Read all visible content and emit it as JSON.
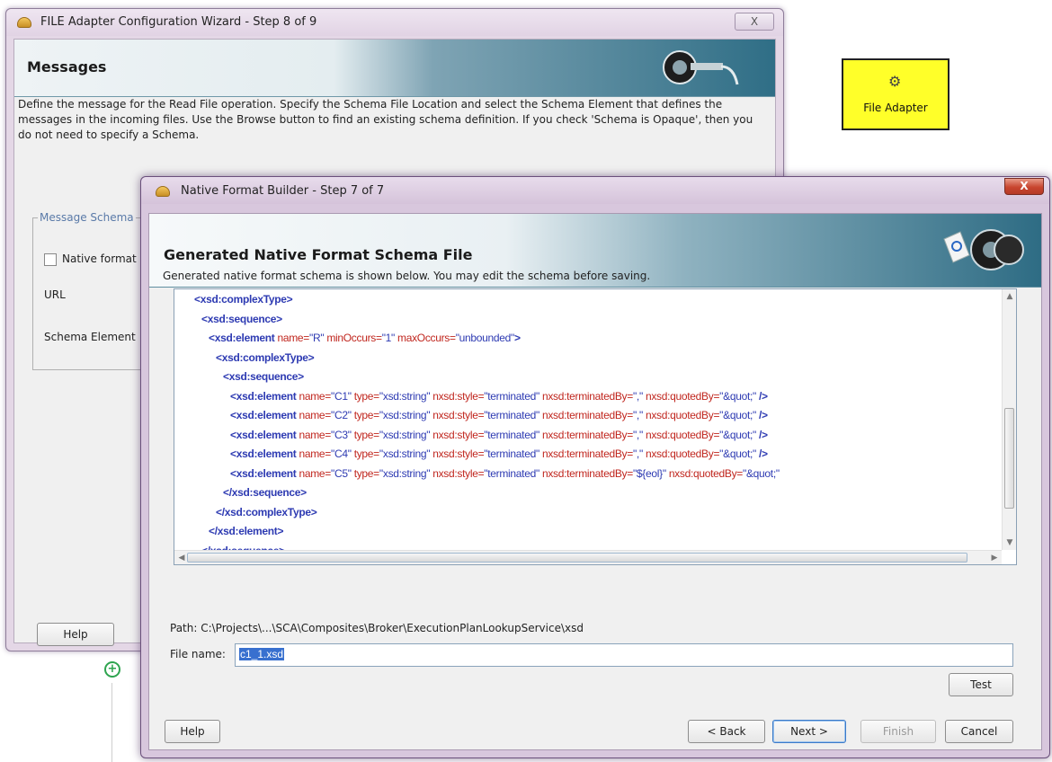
{
  "back_dialog": {
    "title": "FILE Adapter Configuration Wizard - Step 8 of 9",
    "close_label": "X",
    "banner_title": "Messages",
    "description": "Define the message for the Read File operation.  Specify the Schema File Location and select the Schema Element that defines the messages in the incoming files. Use the Browse button to find an existing schema definition. If you check 'Schema is Opaque', then you do not need to specify a Schema.",
    "group_label": "Message Schema",
    "native_format_label": "Native format",
    "url_label": "URL",
    "schema_element_label": "Schema Element",
    "help_label": "Help"
  },
  "canvas": {
    "adapter_label": "File Adapter"
  },
  "front_dialog": {
    "title": "Native Format Builder - Step 7 of 7",
    "close_label": "X",
    "banner_title": "Generated Native Format Schema File",
    "intro": "Generated native format schema is shown below. You may edit the schema before saving.",
    "code_lines": [
      {
        "indent": 0,
        "parts": [
          {
            "c": "t",
            "s": "<xsd:complexType>"
          }
        ]
      },
      {
        "indent": 1,
        "parts": [
          {
            "c": "t",
            "s": "<xsd:sequence>"
          }
        ]
      },
      {
        "indent": 2,
        "parts": [
          {
            "c": "t",
            "s": "<xsd:element "
          },
          {
            "c": "a",
            "s": "name="
          },
          {
            "c": "v",
            "s": "\"R\" "
          },
          {
            "c": "a",
            "s": "minOccurs="
          },
          {
            "c": "v",
            "s": "\"1\" "
          },
          {
            "c": "a",
            "s": "maxOccurs="
          },
          {
            "c": "v",
            "s": "\"unbounded\""
          },
          {
            "c": "t",
            "s": ">"
          }
        ]
      },
      {
        "indent": 3,
        "parts": [
          {
            "c": "t",
            "s": "<xsd:complexType>"
          }
        ]
      },
      {
        "indent": 4,
        "parts": [
          {
            "c": "t",
            "s": "<xsd:sequence>"
          }
        ]
      },
      {
        "indent": 5,
        "parts": [
          {
            "c": "t",
            "s": "<xsd:element "
          },
          {
            "c": "a",
            "s": "name="
          },
          {
            "c": "v",
            "s": "\"C1\" "
          },
          {
            "c": "a",
            "s": "type="
          },
          {
            "c": "v",
            "s": "\"xsd:string\" "
          },
          {
            "c": "a",
            "s": "nxsd:style="
          },
          {
            "c": "v",
            "s": "\"terminated\" "
          },
          {
            "c": "a",
            "s": "nxsd:terminatedBy="
          },
          {
            "c": "v",
            "s": "\",\" "
          },
          {
            "c": "a",
            "s": "nxsd:quotedBy="
          },
          {
            "c": "v",
            "s": "\"&quot;\" "
          },
          {
            "c": "t",
            "s": "/>"
          }
        ]
      },
      {
        "indent": 5,
        "parts": [
          {
            "c": "t",
            "s": "<xsd:element "
          },
          {
            "c": "a",
            "s": "name="
          },
          {
            "c": "v",
            "s": "\"C2\" "
          },
          {
            "c": "a",
            "s": "type="
          },
          {
            "c": "v",
            "s": "\"xsd:string\" "
          },
          {
            "c": "a",
            "s": "nxsd:style="
          },
          {
            "c": "v",
            "s": "\"terminated\" "
          },
          {
            "c": "a",
            "s": "nxsd:terminatedBy="
          },
          {
            "c": "v",
            "s": "\",\" "
          },
          {
            "c": "a",
            "s": "nxsd:quotedBy="
          },
          {
            "c": "v",
            "s": "\"&quot;\" "
          },
          {
            "c": "t",
            "s": "/>"
          }
        ]
      },
      {
        "indent": 5,
        "parts": [
          {
            "c": "t",
            "s": "<xsd:element "
          },
          {
            "c": "a",
            "s": "name="
          },
          {
            "c": "v",
            "s": "\"C3\" "
          },
          {
            "c": "a",
            "s": "type="
          },
          {
            "c": "v",
            "s": "\"xsd:string\" "
          },
          {
            "c": "a",
            "s": "nxsd:style="
          },
          {
            "c": "v",
            "s": "\"terminated\" "
          },
          {
            "c": "a",
            "s": "nxsd:terminatedBy="
          },
          {
            "c": "v",
            "s": "\",\" "
          },
          {
            "c": "a",
            "s": "nxsd:quotedBy="
          },
          {
            "c": "v",
            "s": "\"&quot;\" "
          },
          {
            "c": "t",
            "s": "/>"
          }
        ]
      },
      {
        "indent": 5,
        "parts": [
          {
            "c": "t",
            "s": "<xsd:element "
          },
          {
            "c": "a",
            "s": "name="
          },
          {
            "c": "v",
            "s": "\"C4\" "
          },
          {
            "c": "a",
            "s": "type="
          },
          {
            "c": "v",
            "s": "\"xsd:string\" "
          },
          {
            "c": "a",
            "s": "nxsd:style="
          },
          {
            "c": "v",
            "s": "\"terminated\" "
          },
          {
            "c": "a",
            "s": "nxsd:terminatedBy="
          },
          {
            "c": "v",
            "s": "\",\" "
          },
          {
            "c": "a",
            "s": "nxsd:quotedBy="
          },
          {
            "c": "v",
            "s": "\"&quot;\" "
          },
          {
            "c": "t",
            "s": "/>"
          }
        ]
      },
      {
        "indent": 5,
        "parts": [
          {
            "c": "t",
            "s": "<xsd:element "
          },
          {
            "c": "a",
            "s": "name="
          },
          {
            "c": "v",
            "s": "\"C5\" "
          },
          {
            "c": "a",
            "s": "type="
          },
          {
            "c": "v",
            "s": "\"xsd:string\" "
          },
          {
            "c": "a",
            "s": "nxsd:style="
          },
          {
            "c": "v",
            "s": "\"terminated\" "
          },
          {
            "c": "a",
            "s": "nxsd:terminatedBy="
          },
          {
            "c": "v",
            "s": "\"${eol}\" "
          },
          {
            "c": "a",
            "s": "nxsd:quotedBy="
          },
          {
            "c": "v",
            "s": "\"&quot;\""
          }
        ]
      },
      {
        "indent": 4,
        "parts": [
          {
            "c": "t",
            "s": "</xsd:sequence>"
          }
        ]
      },
      {
        "indent": 3,
        "parts": [
          {
            "c": "t",
            "s": "</xsd:complexType>"
          }
        ]
      },
      {
        "indent": 2,
        "parts": [
          {
            "c": "t",
            "s": "</xsd:element>"
          }
        ]
      },
      {
        "indent": 1,
        "parts": [
          {
            "c": "t",
            "s": "</xsd:sequence>"
          }
        ]
      }
    ],
    "path_text": "Path: C:\\Projects\\...\\SCA\\Composites\\Broker\\ExecutionPlanLookupService\\xsd",
    "filename_label": "File name:",
    "filename_value": "c1_1.xsd",
    "test_label": "Test",
    "help_label": "Help",
    "back_label": "< Back",
    "next_label": "Next >",
    "finish_label": "Finish",
    "cancel_label": "Cancel"
  },
  "colors": {
    "tag": "#2d3ab2",
    "attribute": "#c0261e",
    "adapter_fill": "#ffff29"
  }
}
